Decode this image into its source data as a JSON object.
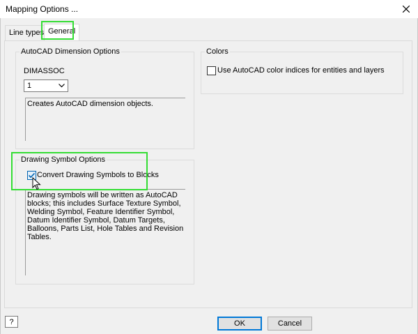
{
  "window": {
    "title": "Mapping Options ...",
    "close_icon": "close-icon"
  },
  "tabs": [
    {
      "label": "Line types",
      "active": false
    },
    {
      "label": "General",
      "active": true
    }
  ],
  "autocad_dimension": {
    "title": "AutoCAD Dimension Options",
    "field_label": "DIMASSOC",
    "selected_value": "1",
    "description": "Creates AutoCAD dimension objects."
  },
  "colors": {
    "title": "Colors",
    "checkbox_label": "Use AutoCAD color indices for entities and layers",
    "checked": false
  },
  "drawing_symbol": {
    "title": "Drawing Symbol Options",
    "checkbox_label": "Convert Drawing Symbols to Blocks",
    "checked": true,
    "description": "Drawing symbols will be written as AutoCAD blocks; this includes Surface Texture Symbol, Welding Symbol, Feature Identifier Symbol, Datum Identifier Symbol, Datum Targets, Balloons, Parts List, Hole Tables and Revision Tables."
  },
  "footer": {
    "help_label": "?",
    "ok_label": "OK",
    "cancel_label": "Cancel"
  },
  "colors_theme": {
    "highlight": "#33dd33",
    "accent": "#0078d7"
  }
}
